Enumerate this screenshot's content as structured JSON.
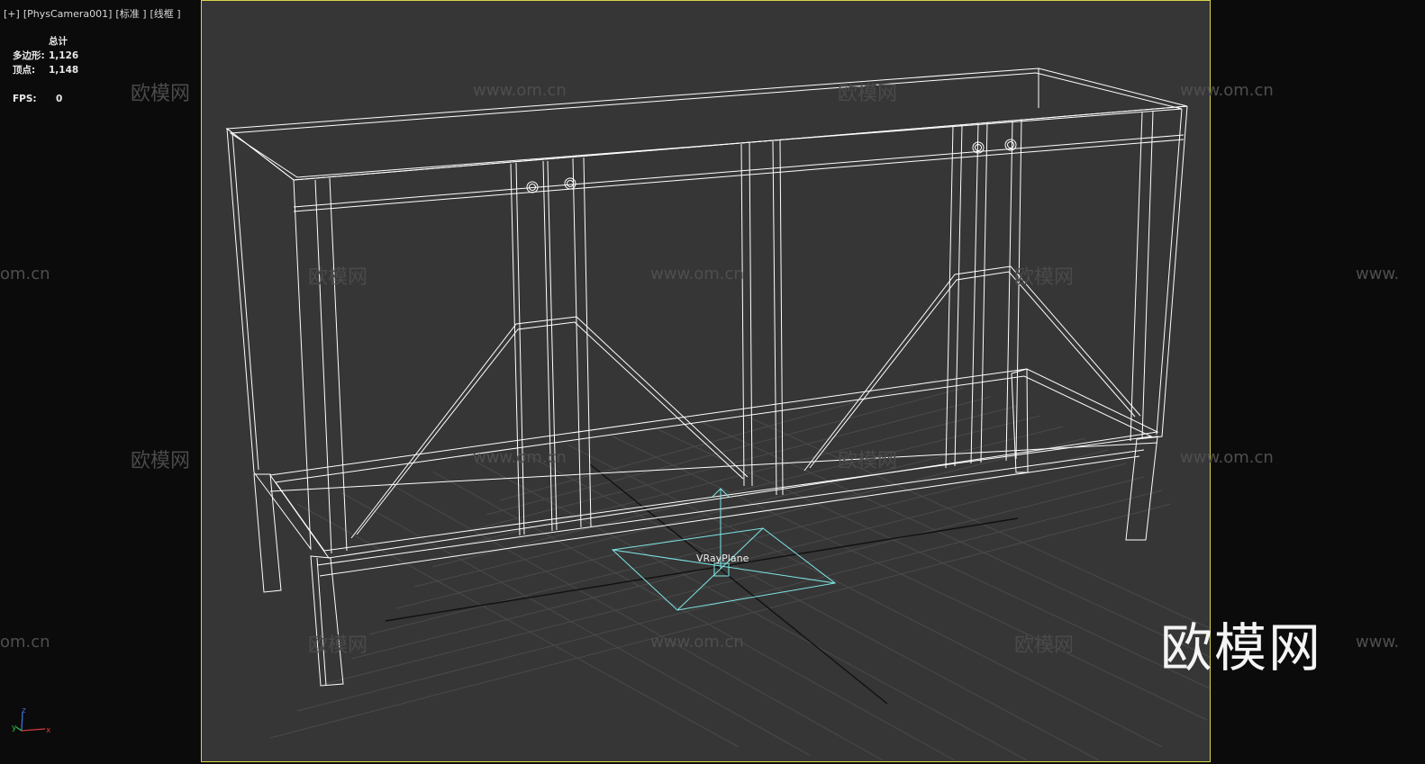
{
  "viewport": {
    "labels": [
      "[+]",
      "[PhysCamera001]",
      "[标准 ]",
      "[线框 ]"
    ]
  },
  "stats": {
    "header": "总计",
    "polygons_label": "多边形:",
    "polygons_value": "1,126",
    "vertices_label": "顶点:",
    "vertices_value": "1,148",
    "fps_label": "FPS:",
    "fps_value": "0"
  },
  "scene": {
    "object_label": "VRayPlane"
  },
  "watermarks": {
    "cn": "欧模网",
    "url": "www.om.cn",
    "url_short": "om.cn",
    "url_left": "www."
  },
  "brand": {
    "logo": "欧模网"
  },
  "axis_tripod": {
    "x": "x",
    "y": "y",
    "z": "z"
  },
  "colors": {
    "frame": "#d9d54a",
    "viewport_bg": "#363636",
    "wire": "#ffffff",
    "plane": "#7fe6e6"
  }
}
